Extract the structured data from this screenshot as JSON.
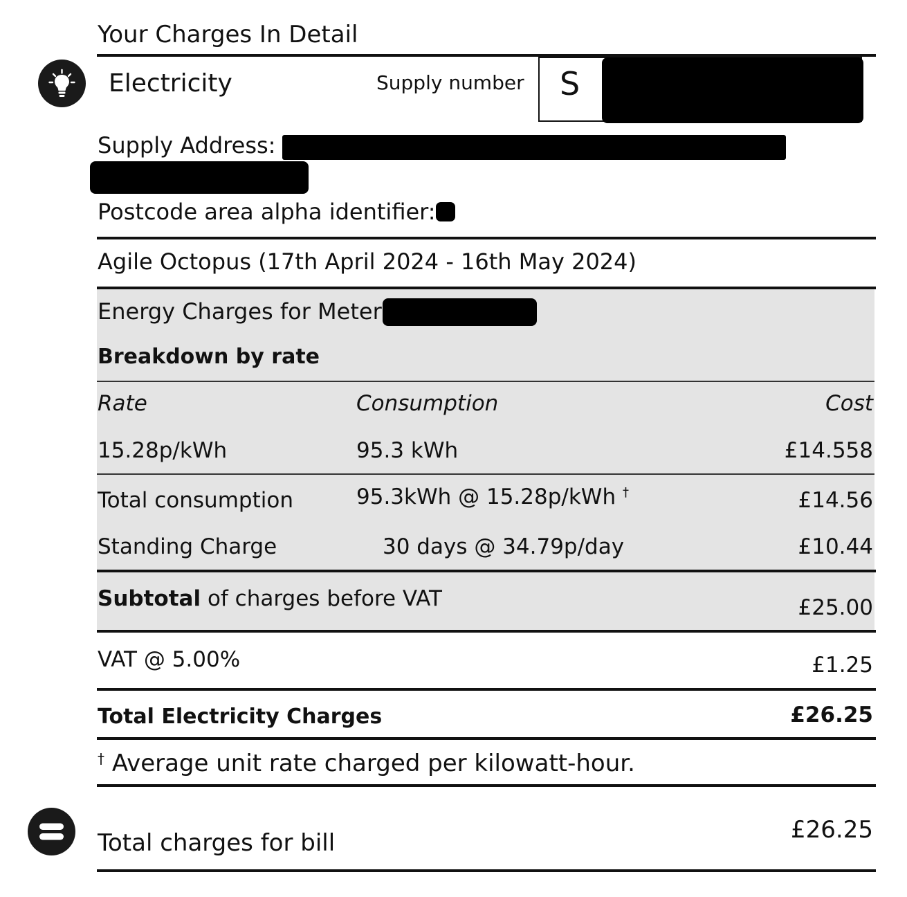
{
  "section_title": "Your Charges In Detail",
  "fuel": {
    "name": "Electricity",
    "icon": "lightbulb-icon",
    "supply_number_label": "Supply number",
    "supply_number_prefix": "S"
  },
  "supply_address_label": "Supply Address:",
  "postcode_label": "Postcode area alpha identifier:",
  "tariff_period": "Agile Octopus (17th April 2024 - 16th May 2024)",
  "meter_heading": "Energy Charges for Meter",
  "breakdown_heading": "Breakdown by rate",
  "breakdown_table": {
    "columns": [
      "Rate",
      "Consumption",
      "Cost"
    ],
    "rows": [
      {
        "rate": "15.28p/kWh",
        "consumption": "95.3 kWh",
        "cost": "£14.558"
      }
    ]
  },
  "total_consumption": {
    "label": "Total consumption",
    "detail": "95.3kWh @ 15.28p/kWh",
    "dagger": "†",
    "cost": "£14.56"
  },
  "standing_charge": {
    "label": "Standing Charge",
    "detail": "30 days @ 34.79p/day",
    "cost": "£10.44"
  },
  "subtotal": {
    "label_bold": "Subtotal",
    "label_rest": "of charges before VAT",
    "cost": "£25.00"
  },
  "vat": {
    "label": "VAT @ 5.00%",
    "cost": "£1.25"
  },
  "total_electricity": {
    "label": "Total Electricity Charges",
    "cost": "£26.25"
  },
  "footnote": {
    "dagger": "†",
    "text": "Average unit rate charged per kilowatt-hour."
  },
  "bill_total": {
    "icon": "equals-icon",
    "label": "Total charges for bill",
    "cost": "£26.25"
  }
}
